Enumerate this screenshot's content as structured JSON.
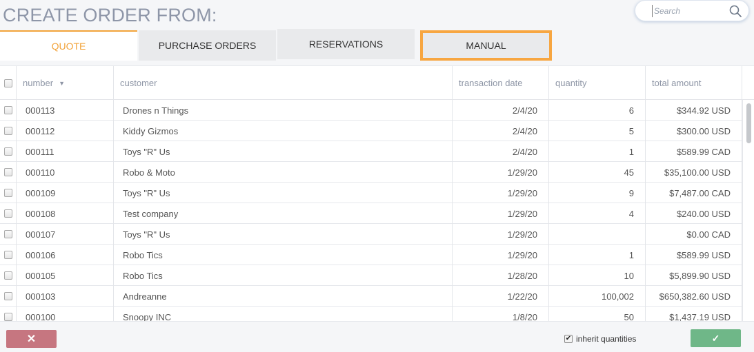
{
  "header": {
    "title": "CREATE ORDER FROM:",
    "search_placeholder": "Search",
    "search_icon": "magnifier"
  },
  "tabs": [
    {
      "label": "QUOTE",
      "active": true
    },
    {
      "label": "PURCHASE ORDERS",
      "active": false
    },
    {
      "label": "RESERVATIONS",
      "active": false
    },
    {
      "label": "MANUAL",
      "active": false,
      "highlighted": true
    }
  ],
  "table": {
    "columns": [
      {
        "label": "number",
        "sort": "descending"
      },
      {
        "label": "customer"
      },
      {
        "label": "transaction date"
      },
      {
        "label": "quantity"
      },
      {
        "label": "total amount"
      }
    ],
    "rows": [
      {
        "number": "000113",
        "customer": "Drones n Things",
        "date": "2/4/20",
        "quantity": "6",
        "total": "$344.92 USD"
      },
      {
        "number": "000112",
        "customer": "Kiddy Gizmos",
        "date": "2/4/20",
        "quantity": "5",
        "total": "$300.00 USD"
      },
      {
        "number": "000111",
        "customer": "Toys \"R\" Us",
        "date": "2/4/20",
        "quantity": "1",
        "total": "$589.99 CAD"
      },
      {
        "number": "000110",
        "customer": "Robo & Moto",
        "date": "1/29/20",
        "quantity": "45",
        "total": "$35,100.00 USD"
      },
      {
        "number": "000109",
        "customer": "Toys \"R\" Us",
        "date": "1/29/20",
        "quantity": "9",
        "total": "$7,487.00 CAD"
      },
      {
        "number": "000108",
        "customer": "Test company",
        "date": "1/29/20",
        "quantity": "4",
        "total": "$240.00 USD"
      },
      {
        "number": "000107",
        "customer": "Toys \"R\" Us",
        "date": "1/29/20",
        "quantity": "",
        "total": "$0.00 CAD"
      },
      {
        "number": "000106",
        "customer": "Robo Tics",
        "date": "1/29/20",
        "quantity": "1",
        "total": "$589.99 USD"
      },
      {
        "number": "000105",
        "customer": "Robo Tics",
        "date": "1/28/20",
        "quantity": "10",
        "total": "$5,899.90 USD"
      },
      {
        "number": "000103",
        "customer": "Andreanne",
        "date": "1/22/20",
        "quantity": "100,002",
        "total": "$650,382.60 USD"
      },
      {
        "number": "000100",
        "customer": "Snoopy INC",
        "date": "1/8/20",
        "quantity": "50",
        "total": "$1,437.19 USD"
      }
    ]
  },
  "footer": {
    "cancel_label": "✕",
    "confirm_label": "✓",
    "inherit_label": "inherit quantities",
    "inherit_checked": true
  },
  "colors": {
    "accent": "#f2a33a",
    "cancel": "#c67680",
    "confirm": "#6fb788",
    "title": "#8e96a8"
  }
}
